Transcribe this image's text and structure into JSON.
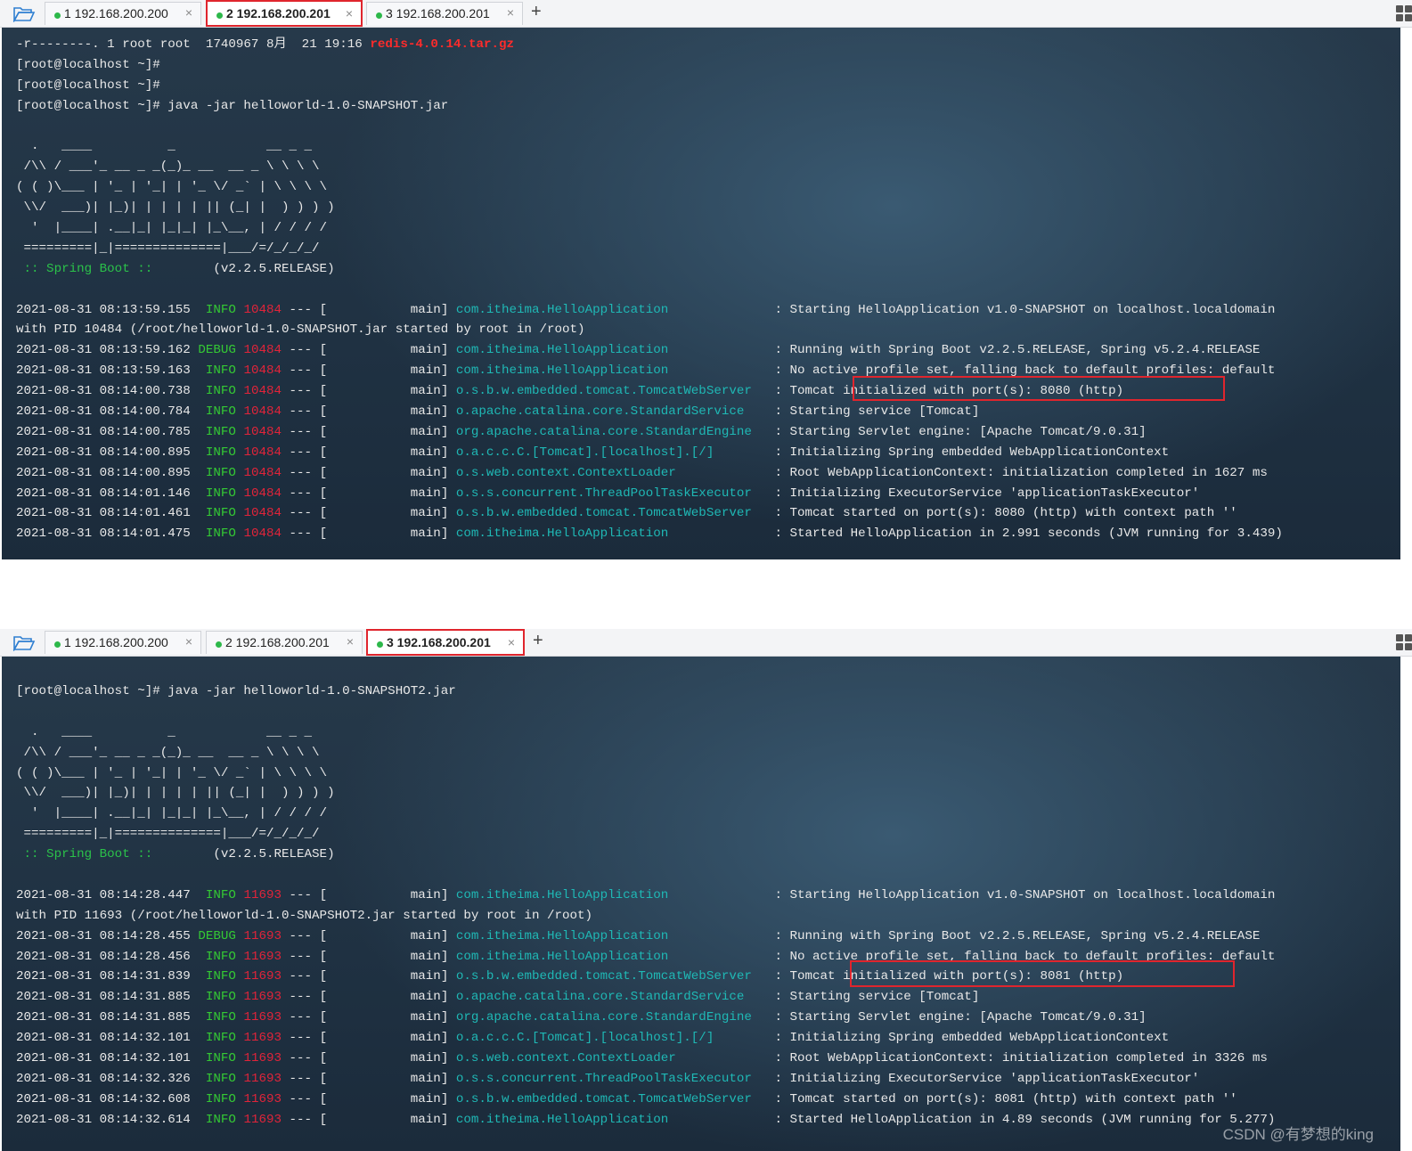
{
  "panel1": {
    "tabs": [
      {
        "label": "1 192.168.200.200",
        "active": false
      },
      {
        "label": "2 192.168.200.201",
        "active": true
      },
      {
        "label": "3 192.168.200.201",
        "active": false
      }
    ],
    "close_glyph": "×",
    "add_tab_glyph": "+",
    "file_listing": "-r--------. 1 root root  1740967 8月  21 19:16 ",
    "file_name": "redis-4.0.14.tar.gz",
    "prompt_lines": [
      "[root@localhost ~]#",
      "[root@localhost ~]#"
    ],
    "command": "[root@localhost ~]# java -jar helloworld-1.0-SNAPSHOT.jar",
    "banner": [
      "  .   ____          _            __ _ _",
      " /\\\\ / ___'_ __ _ _(_)_ __  __ _ \\ \\ \\ \\",
      "( ( )\\___ | '_ | '_| | '_ \\/ _` | \\ \\ \\ \\",
      " \\\\/  ___)| |_)| | | | | || (_| |  ) ) ) )",
      "  '  |____| .__|_| |_|_| |_\\__, | / / / /",
      " =========|_|==============|___/=/_/_/_/"
    ],
    "spring_label": " :: Spring Boot :: ",
    "spring_version": "       (v2.2.5.RELEASE)",
    "logs": [
      {
        "ts": "2021-08-31 08:13:59.155",
        "level": "INFO",
        "pid": "10484",
        "thread": "main",
        "logger": "com.itheima.HelloApplication",
        "msg": "Starting HelloApplication v1.0-SNAPSHOT on localhost.localdomain"
      },
      {
        "continuation": "with PID 10484 (/root/helloworld-1.0-SNAPSHOT.jar started by root in /root)"
      },
      {
        "ts": "2021-08-31 08:13:59.162",
        "level": "DEBUG",
        "pid": "10484",
        "thread": "main",
        "logger": "com.itheima.HelloApplication",
        "msg": "Running with Spring Boot v2.2.5.RELEASE, Spring v5.2.4.RELEASE"
      },
      {
        "ts": "2021-08-31 08:13:59.163",
        "level": "INFO",
        "pid": "10484",
        "thread": "main",
        "logger": "com.itheima.HelloApplication",
        "msg": "No active profile set, falling back to default profiles: default"
      },
      {
        "ts": "2021-08-31 08:14:00.738",
        "level": "INFO",
        "pid": "10484",
        "thread": "main",
        "logger": "o.s.b.w.embedded.tomcat.TomcatWebServer",
        "msg": "Tomcat initialized with port(s): 8080 (http)"
      },
      {
        "ts": "2021-08-31 08:14:00.784",
        "level": "INFO",
        "pid": "10484",
        "thread": "main",
        "logger": "o.apache.catalina.core.StandardService",
        "msg": "Starting service [Tomcat]"
      },
      {
        "ts": "2021-08-31 08:14:00.785",
        "level": "INFO",
        "pid": "10484",
        "thread": "main",
        "logger": "org.apache.catalina.core.StandardEngine",
        "msg": "Starting Servlet engine: [Apache Tomcat/9.0.31]"
      },
      {
        "ts": "2021-08-31 08:14:00.895",
        "level": "INFO",
        "pid": "10484",
        "thread": "main",
        "logger": "o.a.c.c.C.[Tomcat].[localhost].[/]",
        "msg": "Initializing Spring embedded WebApplicationContext"
      },
      {
        "ts": "2021-08-31 08:14:00.895",
        "level": "INFO",
        "pid": "10484",
        "thread": "main",
        "logger": "o.s.web.context.ContextLoader",
        "msg": "Root WebApplicationContext: initialization completed in 1627 ms"
      },
      {
        "ts": "2021-08-31 08:14:01.146",
        "level": "INFO",
        "pid": "10484",
        "thread": "main",
        "logger": "o.s.s.concurrent.ThreadPoolTaskExecutor",
        "msg": "Initializing ExecutorService 'applicationTaskExecutor'"
      },
      {
        "ts": "2021-08-31 08:14:01.461",
        "level": "INFO",
        "pid": "10484",
        "thread": "main",
        "logger": "o.s.b.w.embedded.tomcat.TomcatWebServer",
        "msg": "Tomcat started on port(s): 8080 (http) with context path ''"
      },
      {
        "ts": "2021-08-31 08:14:01.475",
        "level": "INFO",
        "pid": "10484",
        "thread": "main",
        "logger": "com.itheima.HelloApplication",
        "msg": "Started HelloApplication in 2.991 seconds (JVM running for 3.439)"
      }
    ]
  },
  "panel2": {
    "tabs": [
      {
        "label": "1 192.168.200.200",
        "active": false
      },
      {
        "label": "2 192.168.200.201",
        "active": false
      },
      {
        "label": "3 192.168.200.201",
        "active": true
      }
    ],
    "close_glyph": "×",
    "add_tab_glyph": "+",
    "command": "[root@localhost ~]# java -jar helloworld-1.0-SNAPSHOT2.jar",
    "banner": [
      "  .   ____          _            __ _ _",
      " /\\\\ / ___'_ __ _ _(_)_ __  __ _ \\ \\ \\ \\",
      "( ( )\\___ | '_ | '_| | '_ \\/ _` | \\ \\ \\ \\",
      " \\\\/  ___)| |_)| | | | | || (_| |  ) ) ) )",
      "  '  |____| .__|_| |_|_| |_\\__, | / / / /",
      " =========|_|==============|___/=/_/_/_/"
    ],
    "spring_label": " :: Spring Boot :: ",
    "spring_version": "       (v2.2.5.RELEASE)",
    "logs": [
      {
        "ts": "2021-08-31 08:14:28.447",
        "level": "INFO",
        "pid": "11693",
        "thread": "main",
        "logger": "com.itheima.HelloApplication",
        "msg": "Starting HelloApplication v1.0-SNAPSHOT on localhost.localdomain"
      },
      {
        "continuation": "with PID 11693 (/root/helloworld-1.0-SNAPSHOT2.jar started by root in /root)"
      },
      {
        "ts": "2021-08-31 08:14:28.455",
        "level": "DEBUG",
        "pid": "11693",
        "thread": "main",
        "logger": "com.itheima.HelloApplication",
        "msg": "Running with Spring Boot v2.2.5.RELEASE, Spring v5.2.4.RELEASE"
      },
      {
        "ts": "2021-08-31 08:14:28.456",
        "level": "INFO",
        "pid": "11693",
        "thread": "main",
        "logger": "com.itheima.HelloApplication",
        "msg": "No active profile set, falling back to default profiles: default"
      },
      {
        "ts": "2021-08-31 08:14:31.839",
        "level": "INFO",
        "pid": "11693",
        "thread": "main",
        "logger": "o.s.b.w.embedded.tomcat.TomcatWebServer",
        "msg": "Tomcat initialized with port(s): 8081 (http)"
      },
      {
        "ts": "2021-08-31 08:14:31.885",
        "level": "INFO",
        "pid": "11693",
        "thread": "main",
        "logger": "o.apache.catalina.core.StandardService",
        "msg": "Starting service [Tomcat]"
      },
      {
        "ts": "2021-08-31 08:14:31.885",
        "level": "INFO",
        "pid": "11693",
        "thread": "main",
        "logger": "org.apache.catalina.core.StandardEngine",
        "msg": "Starting Servlet engine: [Apache Tomcat/9.0.31]"
      },
      {
        "ts": "2021-08-31 08:14:32.101",
        "level": "INFO",
        "pid": "11693",
        "thread": "main",
        "logger": "o.a.c.c.C.[Tomcat].[localhost].[/]",
        "msg": "Initializing Spring embedded WebApplicationContext"
      },
      {
        "ts": "2021-08-31 08:14:32.101",
        "level": "INFO",
        "pid": "11693",
        "thread": "main",
        "logger": "o.s.web.context.ContextLoader",
        "msg": "Root WebApplicationContext: initialization completed in 3326 ms"
      },
      {
        "ts": "2021-08-31 08:14:32.326",
        "level": "INFO",
        "pid": "11693",
        "thread": "main",
        "logger": "o.s.s.concurrent.ThreadPoolTaskExecutor",
        "msg": "Initializing ExecutorService 'applicationTaskExecutor'"
      },
      {
        "ts": "2021-08-31 08:14:32.608",
        "level": "INFO",
        "pid": "11693",
        "thread": "main",
        "logger": "o.s.b.w.embedded.tomcat.TomcatWebServer",
        "msg": "Tomcat started on port(s): 8081 (http) with context path ''"
      },
      {
        "ts": "2021-08-31 08:14:32.614",
        "level": "INFO",
        "pid": "11693",
        "thread": "main",
        "logger": "com.itheima.HelloApplication",
        "msg": "Started HelloApplication in 4.89 seconds (JVM running for 5.277)"
      }
    ],
    "watermark": "CSDN @有梦想的king"
  },
  "colors": {
    "accent_border": "#e0252d",
    "session_dot": "#2db84a",
    "info": "#34c934",
    "pid": "#e0243a",
    "logger": "#1fb8b5"
  },
  "icons": [
    "folder-open-icon",
    "grid-layout-icon",
    "close-icon",
    "plus-icon"
  ]
}
